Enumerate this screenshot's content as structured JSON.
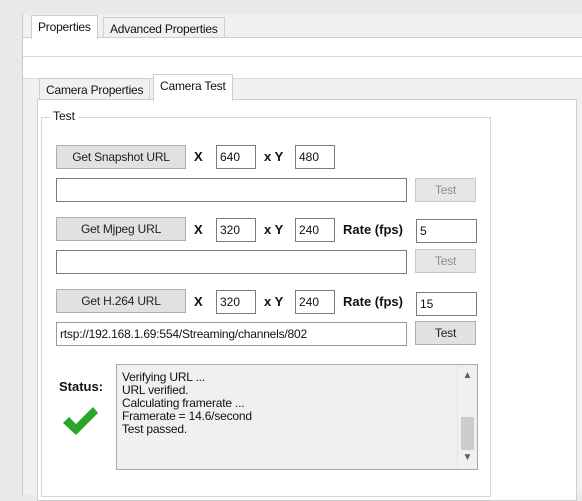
{
  "tabs": {
    "top": [
      "Properties",
      "Advanced Properties"
    ],
    "inner": [
      "Camera Properties",
      "Camera Test"
    ]
  },
  "test_group": {
    "label": "Test"
  },
  "snapshot": {
    "button_label": "Get Snapshot URL",
    "x_label": "X",
    "x_value": "640",
    "y_label": "x Y",
    "y_value": "480",
    "url": "",
    "test_label": "Test"
  },
  "mjpeg": {
    "button_label": "Get Mjpeg URL",
    "x_label": "X",
    "x_value": "320",
    "y_label": "x Y",
    "y_value": "240",
    "rate_label": "Rate (fps)",
    "rate_value": "5",
    "url": "",
    "test_label": "Test"
  },
  "h264": {
    "button_label": "Get H.264 URL",
    "x_label": "X",
    "x_value": "320",
    "y_label": "x Y",
    "y_value": "240",
    "rate_label": "Rate (fps)",
    "rate_value": "15",
    "url": "rtsp://192.168.1.69:554/Streaming/channels/802",
    "test_label": "Test"
  },
  "status": {
    "label": "Status:",
    "icon": "checkmark-icon",
    "icon_color": "#2aa52a",
    "lines": [
      "Verifying URL ...",
      "URL verified.",
      "Calculating framerate ...",
      "Framerate = 14.6/second",
      "Test passed."
    ]
  }
}
